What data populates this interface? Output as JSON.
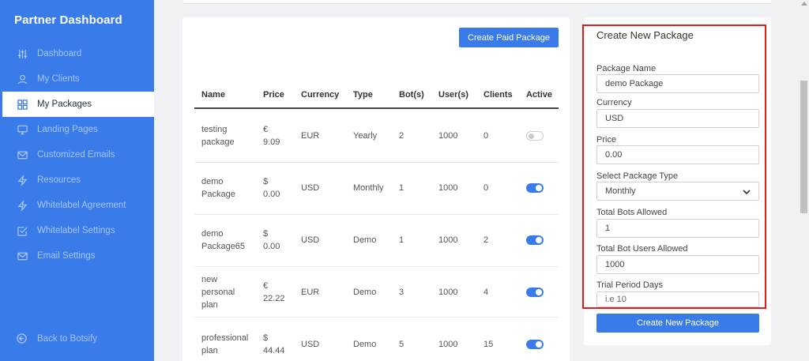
{
  "sidebar": {
    "brand": "Partner Dashboard",
    "items": [
      {
        "label": "Dashboard",
        "icon": "sliders-icon"
      },
      {
        "label": "My Clients",
        "icon": "user-icon"
      },
      {
        "label": "My Packages",
        "icon": "grid-icon",
        "active": true
      },
      {
        "label": "Landing Pages",
        "icon": "monitor-icon"
      },
      {
        "label": "Customized Emails",
        "icon": "mail-icon"
      },
      {
        "label": "Resources",
        "icon": "zap-icon"
      },
      {
        "label": "Whitelabel Agreement",
        "icon": "zap-icon"
      },
      {
        "label": "Whitelabel Settings",
        "icon": "check-square-icon"
      },
      {
        "label": "Email Settings",
        "icon": "mail-icon"
      }
    ],
    "back_label": "Back to Botsify"
  },
  "table": {
    "create_paid_label": "Create Paid Package",
    "columns": [
      "Name",
      "Price",
      "Currency",
      "Type",
      "Bot(s)",
      "User(s)",
      "Clients",
      "Active"
    ],
    "rows": [
      {
        "name": "testing package",
        "price": "€ 9.09",
        "currency": "EUR",
        "type": "Yearly",
        "bots": "2",
        "users": "1000",
        "clients": "0",
        "active": false
      },
      {
        "name": "demo Package",
        "price": "$ 0.00",
        "currency": "USD",
        "type": "Monthly",
        "bots": "1",
        "users": "1000",
        "clients": "0",
        "active": true
      },
      {
        "name": "demo Package65",
        "price": "$ 0.00",
        "currency": "USD",
        "type": "Demo",
        "bots": "1",
        "users": "1000",
        "clients": "2",
        "active": true
      },
      {
        "name": "new personal plan",
        "price": "€ 22.22",
        "currency": "EUR",
        "type": "Demo",
        "bots": "3",
        "users": "1000",
        "clients": "4",
        "active": true
      },
      {
        "name": "professional plan",
        "price": "$ 44.44",
        "currency": "USD",
        "type": "Demo",
        "bots": "5",
        "users": "1000",
        "clients": "15",
        "active": true
      }
    ]
  },
  "form": {
    "title": "Create New Package",
    "package_name_label": "Package Name",
    "package_name_value": "demo Package",
    "currency_label": "Currency",
    "currency_value": "USD",
    "price_label": "Price",
    "price_value": "0.00",
    "type_label": "Select Package Type",
    "type_value": "Monthly",
    "bots_label": "Total Bots Allowed",
    "bots_value": "1",
    "users_label": "Total Bot Users Allowed",
    "users_value": "1000",
    "trial_label": "Trial Period Days",
    "trial_placeholder": "i.e 10",
    "submit_label": "Create New Package"
  },
  "colors": {
    "accent": "#3a7bea",
    "highlight": "#e31b1b"
  }
}
